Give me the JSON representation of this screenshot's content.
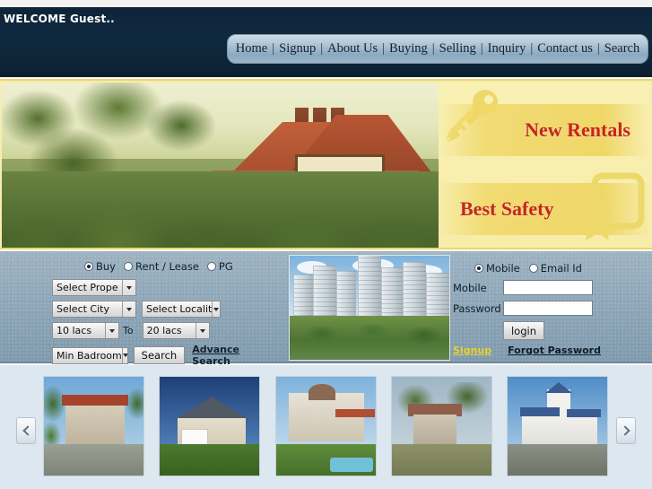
{
  "header": {
    "welcome_text": "WELCOME Guest..",
    "nav_items": [
      {
        "label": "Home"
      },
      {
        "label": "Signup"
      },
      {
        "label": "About Us"
      },
      {
        "label": "Buying"
      },
      {
        "label": "Selling"
      },
      {
        "label": "Inquiry"
      },
      {
        "label": "Contact us"
      },
      {
        "label": "Search"
      }
    ],
    "nav_separator": "|"
  },
  "banner": {
    "promos": [
      {
        "label": "New Rentals",
        "icon": "keys-icon"
      },
      {
        "label": "Best Safety",
        "icon": "certificate-icon"
      }
    ],
    "photo_alt": "brick tudor house with garden hedges"
  },
  "search_form": {
    "deal_types": [
      {
        "label": "Buy",
        "selected": true
      },
      {
        "label": "Rent / Lease",
        "selected": false
      },
      {
        "label": "PG",
        "selected": false
      }
    ],
    "property_type": "Select Prope",
    "city": "Select City",
    "locality": "Select Localit",
    "price_min": "10 lacs",
    "price_to_label": "To",
    "price_max": "20 lacs",
    "bedrooms": "Min Badroom",
    "search_button": "Search",
    "advance_search_link": "Advance Search"
  },
  "center_image": {
    "alt": "high-rise apartment complex with landscaped garden"
  },
  "login": {
    "id_types": [
      {
        "label": "Mobile",
        "selected": true
      },
      {
        "label": "Email Id",
        "selected": false
      }
    ],
    "mobile_label": "Mobile",
    "mobile_value": "",
    "mobile_placeholder": "",
    "password_label": "Password",
    "password_value": "",
    "password_placeholder": "",
    "login_button": "login",
    "signup_link": "Signup",
    "forgot_link": "Forgot Password",
    "signup_color": "#e8d32a",
    "forgot_color": "#0d1c28"
  },
  "carousel": {
    "prev_label": "‹",
    "next_label": "›",
    "items": [
      {
        "alt": "two-storey cream duplex with palm trees"
      },
      {
        "alt": "white suburban bungalow with garage"
      },
      {
        "alt": "villa with pergola and swimming pool"
      },
      {
        "alt": "small cottage with tiled roof and garden"
      },
      {
        "alt": "white mansion with blue roof and tower"
      }
    ]
  },
  "colors": {
    "header_bg": "#10293f",
    "banner_bg": "#f6edb0",
    "promo_text": "#c62521",
    "midband_bg": "#8fa7b9",
    "carousel_bg": "#dde7ef"
  }
}
